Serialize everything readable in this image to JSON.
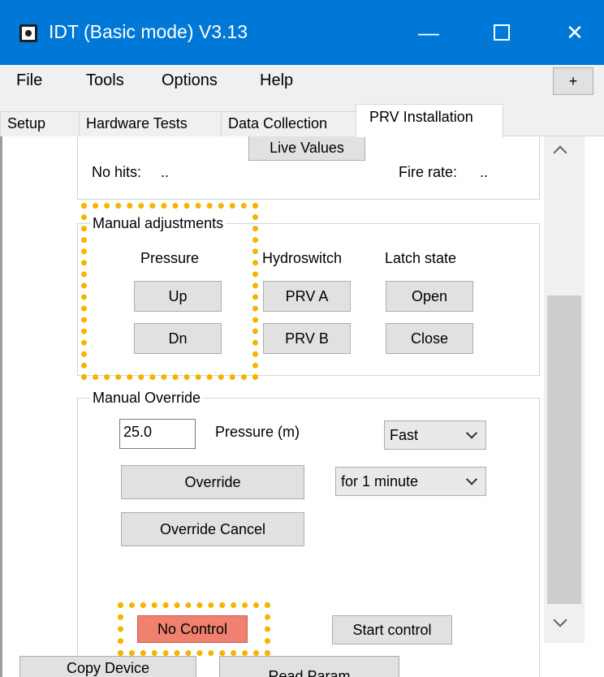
{
  "window": {
    "title": "IDT (Basic mode) V3.13",
    "minimize": "—",
    "close": "✕"
  },
  "menu": {
    "items": [
      "File",
      "Tools",
      "Options",
      "Help"
    ],
    "plus": "+"
  },
  "tabs": [
    "Setup",
    "Hardware Tests",
    "Data Collection",
    "PRV Installation"
  ],
  "top_group": {
    "live_values": "Live Values",
    "no_hits_label": "No hits:",
    "no_hits_value": "..",
    "fire_rate_label": "Fire rate:",
    "fire_rate_value": ".."
  },
  "manual_adjustments": {
    "title": "Manual adjustments",
    "pressure_label": "Pressure",
    "hydroswitch_label": "Hydroswitch",
    "latch_label": "Latch state",
    "up": "Up",
    "dn": "Dn",
    "prv_a": "PRV A",
    "prv_b": "PRV B",
    "open": "Open",
    "close": "Close"
  },
  "manual_override": {
    "title": "Manual Override",
    "pressure_value": "25.0",
    "pressure_label": "Pressure (m)",
    "speed_selected": "Fast",
    "duration_selected": "for 1 minute",
    "override": "Override",
    "override_cancel": "Override Cancel"
  },
  "bottom": {
    "no_control": "No Control",
    "start_control": "Start control",
    "copy_device": "Copy Device",
    "read_params": "Read Param"
  },
  "colors": {
    "titlebar": "#0078d7",
    "no_control_bg": "#f08070",
    "highlight": "#f4b400"
  },
  "icons": [
    "app-icon",
    "minimize-icon",
    "maximize-icon",
    "close-icon",
    "chevron-up-icon",
    "chevron-down-icon"
  ]
}
